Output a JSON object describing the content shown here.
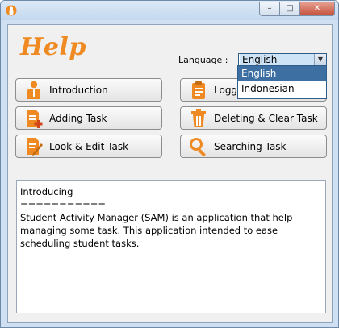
{
  "titlebar": {
    "icon": "app-person-icon",
    "minimize": "–",
    "maximize": "□",
    "close": "✕"
  },
  "header": {
    "title": "Help"
  },
  "language": {
    "label": "Language :",
    "selected": "English",
    "options": [
      "English",
      "Indonesian"
    ]
  },
  "buttons": {
    "introduction": "Introduction",
    "logging": "Logging In",
    "adding": "Adding Task",
    "deleting": "Deleting & Clear Task",
    "look": "Look & Edit Task",
    "searching": "Searching Task"
  },
  "content": {
    "text": "Introducing\n===========\nStudent Activity Manager (SAM) is an application that help managing some task. This application intended to ease scheduling student tasks."
  },
  "colors": {
    "accent": "#ef8a22",
    "selection": "#3d6fa3"
  }
}
